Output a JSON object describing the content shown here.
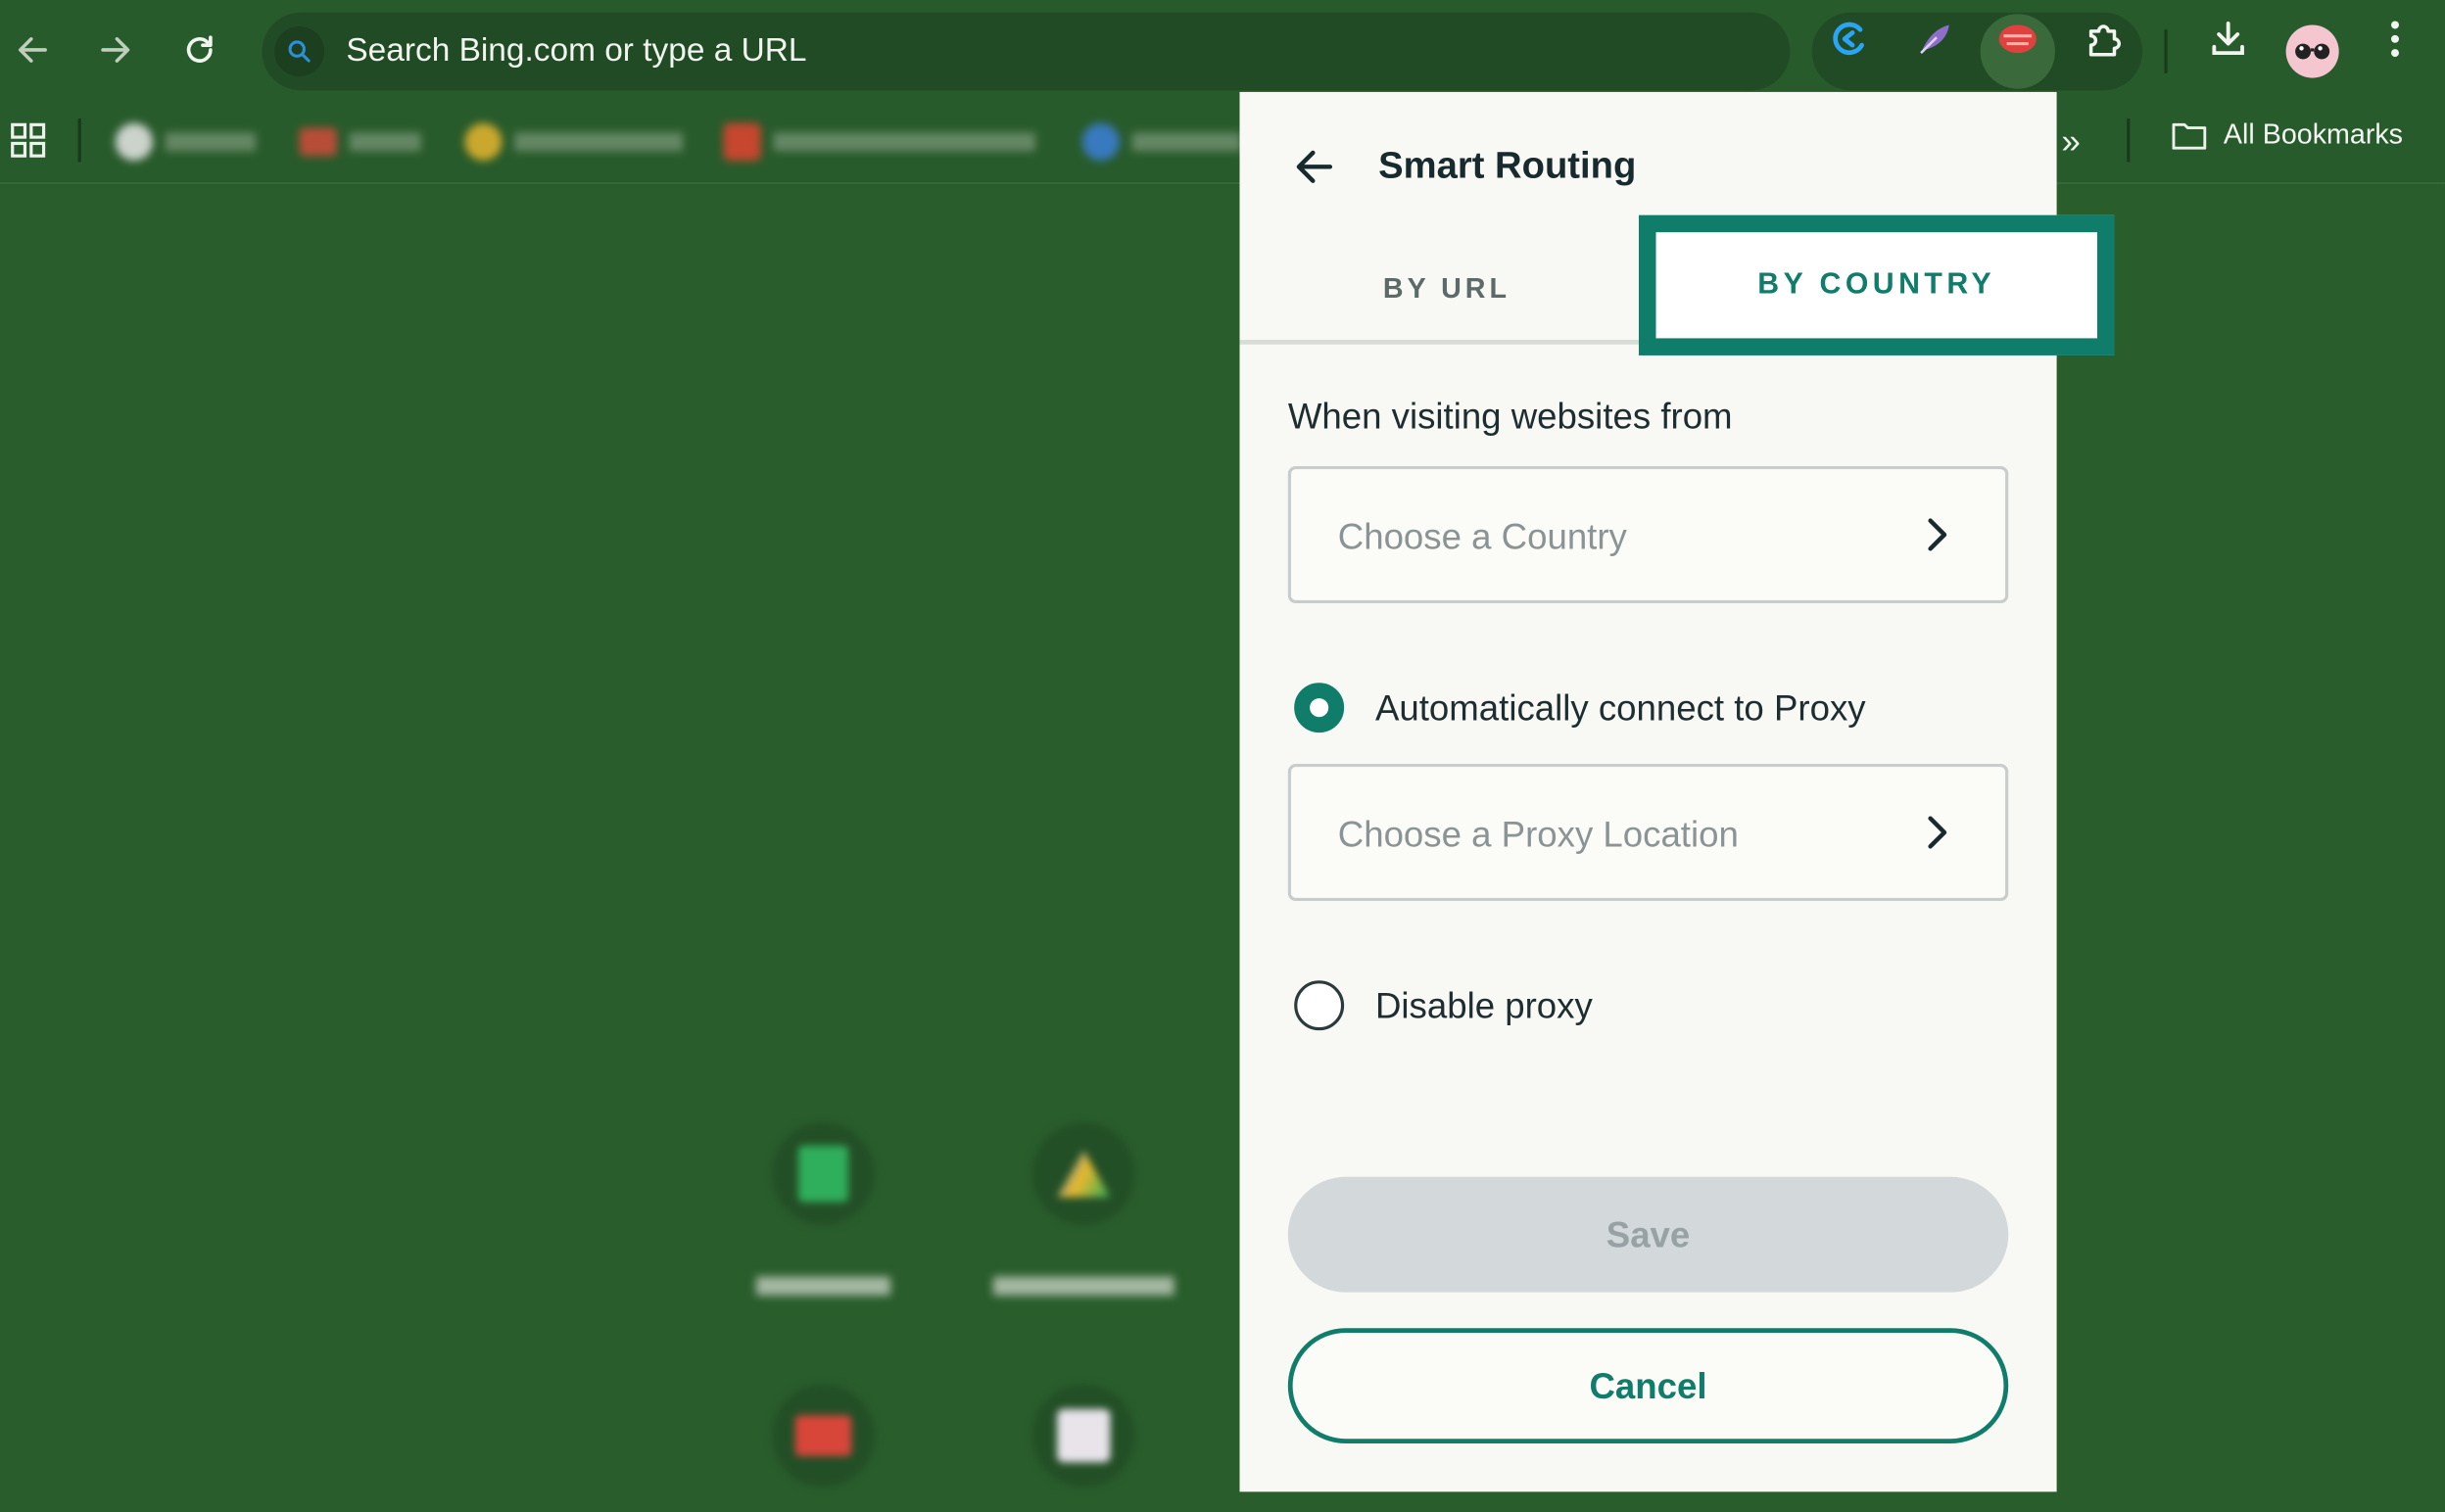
{
  "browser": {
    "omnibox_text": "Search Bing.com or type a URL",
    "all_bookmarks_label": "All Bookmarks",
    "overflow_glyph": "»"
  },
  "popup": {
    "title": "Smart Routing",
    "tabs": [
      {
        "label": "BY URL",
        "selected": false
      },
      {
        "label": "BY COUNTRY",
        "selected": true
      }
    ],
    "section_label": "When visiting websites from",
    "country_placeholder": "Choose a Country",
    "option_auto_label": "Automatically connect to Proxy",
    "option_auto_selected": true,
    "proxy_placeholder": "Choose a Proxy Location",
    "option_disable_label": "Disable proxy",
    "option_disable_selected": false,
    "save_label": "Save",
    "cancel_label": "Cancel"
  },
  "colors": {
    "accent": "#107c6a",
    "page_background": "#295d2c",
    "popup_background": "#f8f8f4",
    "save_disabled": "#d3d8da"
  }
}
